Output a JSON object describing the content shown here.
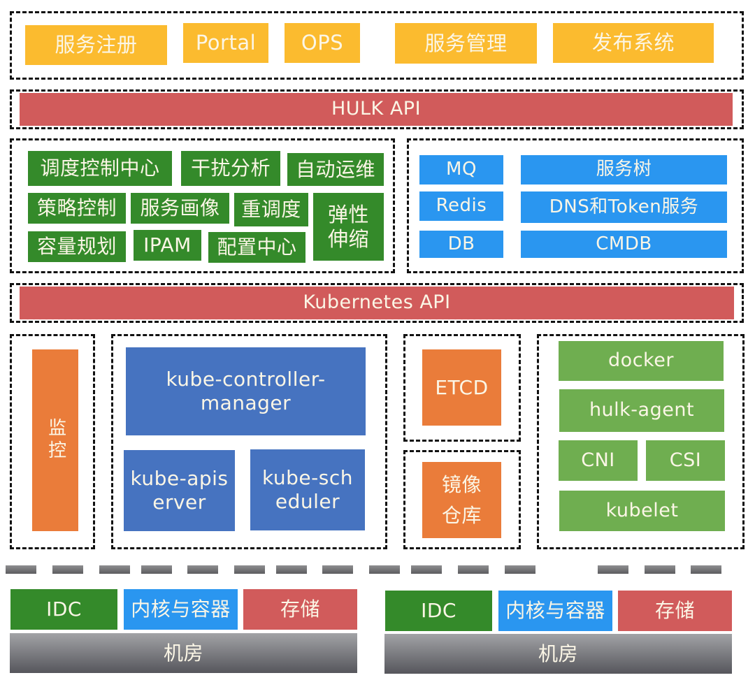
{
  "diagram": {
    "layer_portal": {
      "items": [
        "服务注册",
        "Portal",
        "OPS",
        "服务管理",
        "发布系统"
      ]
    },
    "hulk_api": "HULK API",
    "control_plane": {
      "items": [
        "调度控制中心",
        "干扰分析",
        "自动运维",
        "策略控制",
        "服务画像",
        "重调度",
        "弹性\n伸缩",
        "容量规划",
        "IPAM",
        "配置中心"
      ]
    },
    "middleware": {
      "left": [
        "MQ",
        "Redis",
        "DB"
      ],
      "right": [
        "服务树",
        "DNS和Token服务",
        "CMDB"
      ]
    },
    "kubernetes_api": "Kubernetes API",
    "monitoring": "监控",
    "k8s_master": {
      "controller_manager": "kube-controller-manager",
      "apiserver": "kube-apiserver",
      "scheduler": "kube-scheduler"
    },
    "etcd": "ETCD",
    "registry": "镜像仓库",
    "node": {
      "docker": "docker",
      "hulk_agent": "hulk-agent",
      "cni": "CNI",
      "csi": "CSI",
      "kubelet": "kubelet"
    },
    "datacenters": [
      {
        "idc": "IDC",
        "kernel": "内核与容器",
        "storage": "存储",
        "room": "机房"
      },
      {
        "idc": "IDC",
        "kernel": "内核与容器",
        "storage": "存储",
        "room": "机房"
      }
    ],
    "colors": {
      "portal": "#fbbb2f",
      "api_bar": "#d15b5b",
      "control": "#348a2a",
      "middleware": "#2a96f0",
      "k8s_master": "#4673c0",
      "orange": "#ea7c3a",
      "node": "#6fae50",
      "room": "#707074"
    }
  }
}
